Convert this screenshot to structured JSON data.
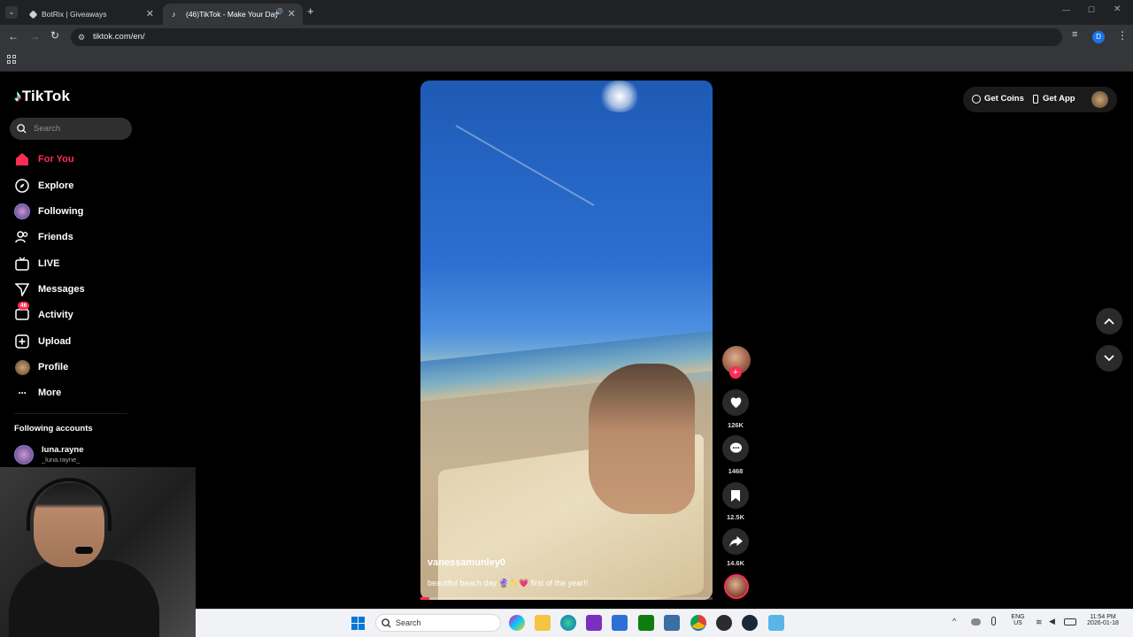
{
  "browser": {
    "tabs": [
      {
        "title": "BotRix | Giveaways"
      },
      {
        "title": "(46)TikTok - Make Your Day"
      }
    ],
    "url": "tiktok.com/en/"
  },
  "tiktok": {
    "logo_text": "TikTok",
    "search_placeholder": "Search",
    "nav": [
      {
        "label": "For You",
        "icon": "home-icon"
      },
      {
        "label": "Explore",
        "icon": "compass-icon"
      },
      {
        "label": "Following",
        "icon": "following-avatar-icon"
      },
      {
        "label": "Friends",
        "icon": "friends-icon"
      },
      {
        "label": "LIVE",
        "icon": "live-icon"
      },
      {
        "label": "Messages",
        "icon": "messages-icon"
      },
      {
        "label": "Activity",
        "icon": "activity-icon",
        "badge": "46"
      },
      {
        "label": "Upload",
        "icon": "upload-icon"
      },
      {
        "label": "Profile",
        "icon": "profile-avatar-icon"
      },
      {
        "label": "More",
        "icon": "more-icon"
      }
    ],
    "following_title": "Following accounts",
    "following_accounts": [
      {
        "name": "luna.rayne",
        "handle": "_luna.rayne_"
      }
    ],
    "top_right": {
      "coins_label": "Get Coins",
      "app_label": "Get App"
    },
    "video": {
      "username": "vanessamunley0",
      "description": "beautiful beach day 🔮✨💗 first of the year!!",
      "progress": 0.03,
      "likes": "126K",
      "comments": "1468",
      "saves": "12.5K",
      "shares": "14.6K"
    }
  },
  "taskbar": {
    "search_placeholder": "Search",
    "lang_top": "ENG",
    "lang_bottom": "US",
    "time": "11:54 PM",
    "date": "2026-01-18"
  },
  "colors": {
    "accent": "#fe2c55",
    "background": "#000000"
  }
}
